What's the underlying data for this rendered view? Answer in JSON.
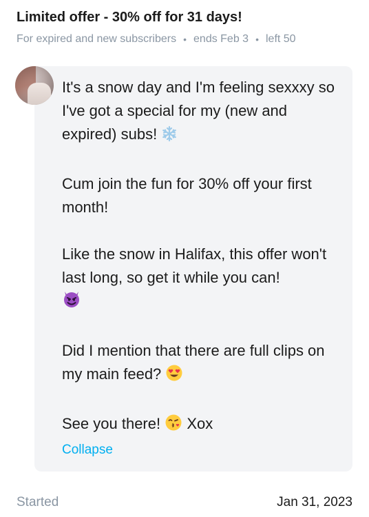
{
  "offer": {
    "title": "Limited offer - 30% off for 31 days!",
    "audience": "For expired and new subscribers",
    "ends": "ends Feb 3",
    "left": "left 50"
  },
  "message": {
    "p1": "It's a snow day and I'm feeling sexxxy so I've got a special for my (new and expired) subs!",
    "p1_emoji": "snowflake-icon",
    "p2": "Cum join the fun for 30% off your first month!",
    "p3": "Like the snow in Halifax, this offer won't last long, so get it while you can!",
    "p3_emoji": "smiling-devil-icon",
    "p4": "Did I mention that there are full clips on my main feed?",
    "p4_emoji": "heart-eyes-icon",
    "p5_a": "See you there!",
    "p5_emoji": "kiss-face-icon",
    "p5_b": "Xox",
    "collapse_label": "Collapse"
  },
  "footer": {
    "label": "Started",
    "date": "Jan 31, 2023"
  },
  "colors": {
    "link": "#00aff0",
    "muted": "#8a96a3",
    "bubble_bg": "#f3f4f6"
  }
}
